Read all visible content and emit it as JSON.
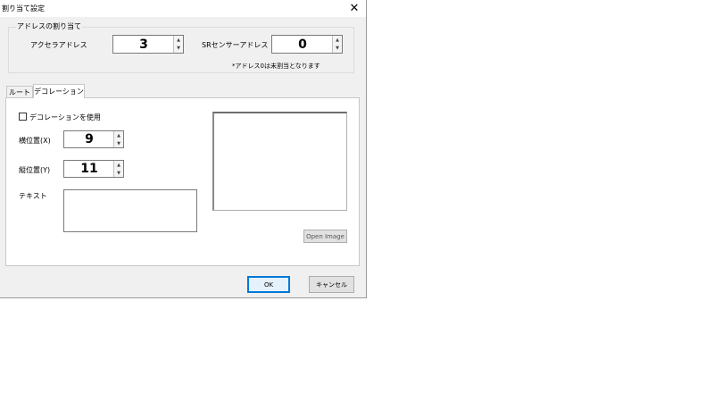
{
  "window": {
    "title": "割り当て設定",
    "close_glyph": "✕"
  },
  "address_group": {
    "label": "アドレスの割り当て",
    "access_label": "アクセラアドレス",
    "access_value": "3",
    "sensor_label": "SRセンサーアドレス",
    "sensor_value": "0",
    "note": "*アドレス0は未割当となります"
  },
  "tabs": [
    {
      "label": "ルート"
    },
    {
      "label": "デコレーション"
    }
  ],
  "decoration": {
    "use_checkbox_label": "デコレーションを使用",
    "use_checked": false,
    "horizontal_label": "横位置(X)",
    "horizontal_value": "9",
    "vertical_label": "縦位置(Y)",
    "vertical_value": "11",
    "text_label": "テキスト",
    "text_value": "",
    "open_image_label": "Open Image"
  },
  "footer": {
    "ok_label": "OK",
    "cancel_label": "キャンセル"
  },
  "icons": {
    "spin_up": "▲",
    "spin_down": "▼"
  }
}
